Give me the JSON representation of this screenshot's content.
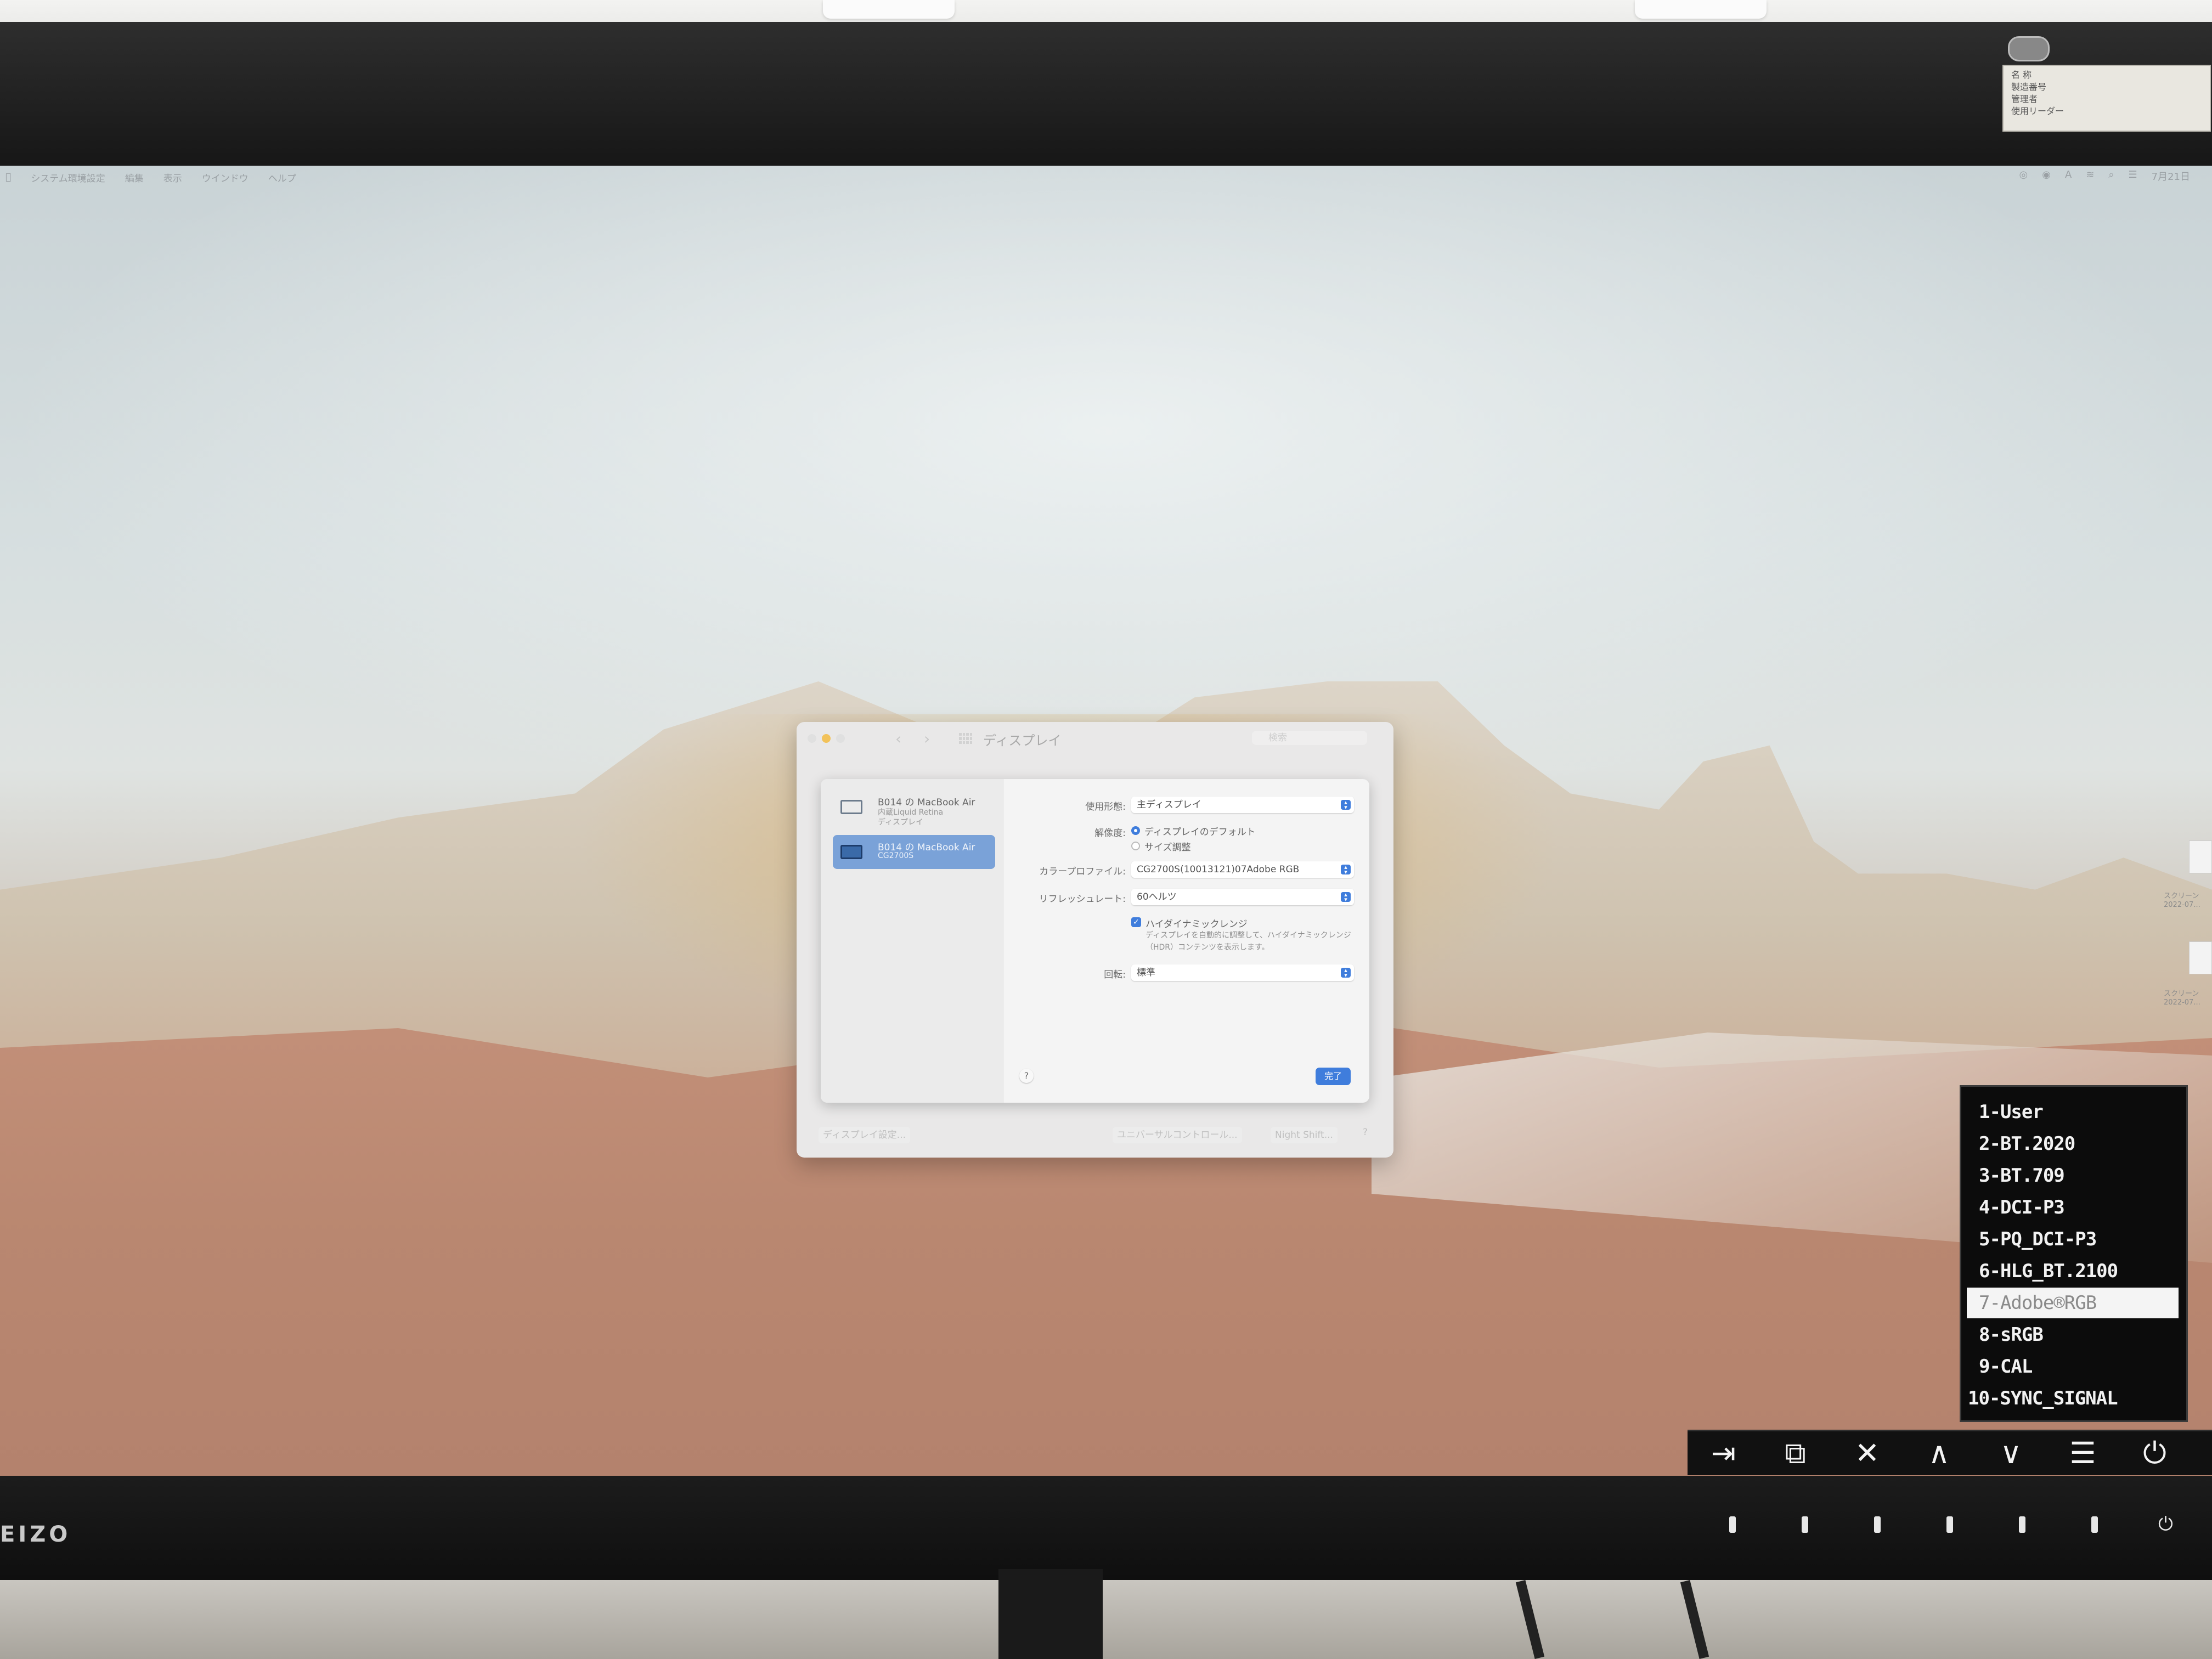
{
  "menubar": {
    "items": [
      "システム環境設定",
      "編集",
      "表示",
      "ウインドウ",
      "ヘルプ"
    ],
    "right_icons": [
      "status-icon",
      "status-icon",
      "keyboard-icon",
      "wifi-icon",
      "search-icon",
      "control-center-icon"
    ],
    "clock": "7月21日"
  },
  "sticker": {
    "lines": [
      "名 称",
      "製造番号",
      "管理者",
      "使用リーダー"
    ]
  },
  "window": {
    "title": "ディスプレイ",
    "search_placeholder": "検索",
    "displays": [
      {
        "name": "B014 の MacBook Air",
        "sub": "内蔵Liquid Retina",
        "sub2": "ディスプレイ",
        "selected": false
      },
      {
        "name": "B014 の MacBook Air",
        "sub": "CG2700S",
        "selected": true
      }
    ],
    "settings": {
      "use_as_label": "使用形態:",
      "use_as_value": "主ディスプレイ",
      "resolution_label": "解像度:",
      "resolution_options": [
        "ディスプレイのデフォルト",
        "サイズ調整"
      ],
      "resolution_selected": 0,
      "color_profile_label": "カラープロファイル:",
      "color_profile_value": "CG2700S(10013121)07Adobe RGB",
      "refresh_label": "リフレッシュレート:",
      "refresh_value": "60ヘルツ",
      "hdr_label": "ハイダイナミックレンジ",
      "hdr_checked": true,
      "hdr_desc": "ディスプレイを自動的に調整して、ハイダイナミックレンジ（HDR）コンテンツを表示します。",
      "rotation_label": "回転:",
      "rotation_value": "標準"
    },
    "help_label": "?",
    "done_label": "完了",
    "footer": {
      "display_settings": "ディスプレイ設定...",
      "universal_control": "ユニバーサルコントロール...",
      "night_shift": "Night Shift...",
      "help": "?"
    }
  },
  "desktop_icons": [
    {
      "label": "スクリーン",
      "date": "2022-07..."
    },
    {
      "label": "スクリーン",
      "date": "2022-07..."
    }
  ],
  "osd": {
    "items": [
      "1-User",
      "2-BT.2020",
      "3-BT.709",
      "4-DCI-P3",
      "5-PQ_DCI-P3",
      "6-HLG_BT.2100",
      "7-Adobe®RGB",
      "8-sRGB",
      "9-CAL",
      "10-SYNC_SIGNAL"
    ],
    "selected_index": 6,
    "buttons": [
      "input-icon",
      "pip-icon",
      "close-icon",
      "up-icon",
      "down-icon",
      "menu-icon",
      "power-icon"
    ]
  },
  "brand": "EIZO"
}
